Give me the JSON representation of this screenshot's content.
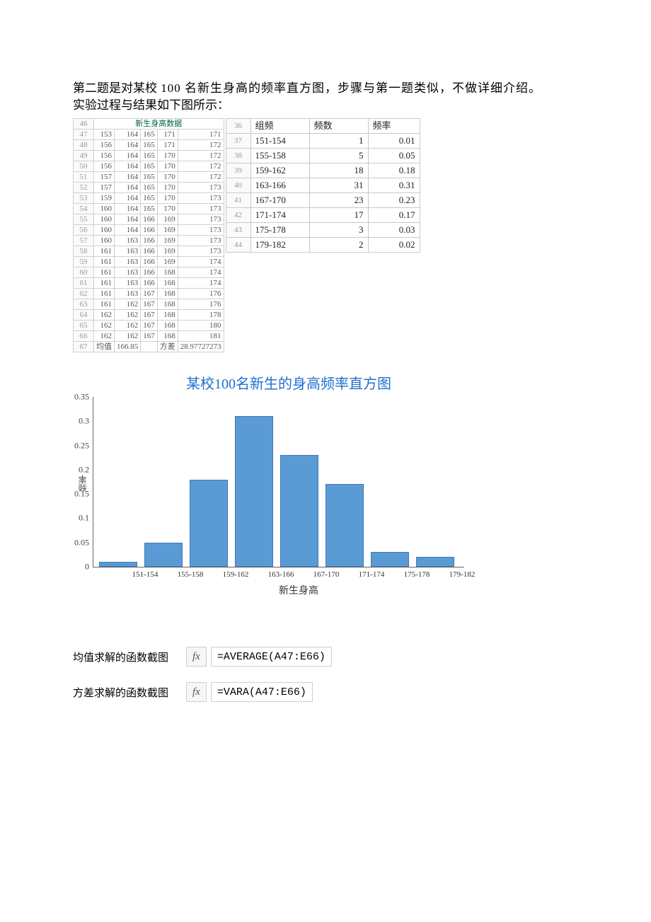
{
  "intro": {
    "line1a": "第二题是对某校",
    "line1b": " 100 名新生身高的频率直方图，步骤与第一题类似，不做详细介绍。",
    "line2": "实验过程与结果如下图所示："
  },
  "sheet1": {
    "header": "新生身高数据",
    "rows": [
      {
        "n": "46",
        "c": [
          "",
          "",
          "",
          "",
          ""
        ]
      },
      {
        "n": "47",
        "c": [
          "153",
          "164",
          "165",
          "171",
          "171"
        ]
      },
      {
        "n": "48",
        "c": [
          "156",
          "164",
          "165",
          "171",
          "172"
        ]
      },
      {
        "n": "49",
        "c": [
          "156",
          "164",
          "165",
          "170",
          "172"
        ]
      },
      {
        "n": "50",
        "c": [
          "156",
          "164",
          "165",
          "170",
          "172"
        ]
      },
      {
        "n": "51",
        "c": [
          "157",
          "164",
          "165",
          "170",
          "172"
        ]
      },
      {
        "n": "52",
        "c": [
          "157",
          "164",
          "165",
          "170",
          "173"
        ]
      },
      {
        "n": "53",
        "c": [
          "159",
          "164",
          "165",
          "170",
          "173"
        ]
      },
      {
        "n": "54",
        "c": [
          "160",
          "164",
          "165",
          "170",
          "173"
        ]
      },
      {
        "n": "55",
        "c": [
          "160",
          "164",
          "166",
          "169",
          "173"
        ]
      },
      {
        "n": "56",
        "c": [
          "160",
          "164",
          "166",
          "169",
          "173"
        ]
      },
      {
        "n": "57",
        "c": [
          "160",
          "163",
          "166",
          "169",
          "173"
        ]
      },
      {
        "n": "58",
        "c": [
          "161",
          "163",
          "166",
          "169",
          "173"
        ]
      },
      {
        "n": "59",
        "c": [
          "161",
          "163",
          "166",
          "169",
          "174"
        ]
      },
      {
        "n": "60",
        "c": [
          "161",
          "163",
          "166",
          "168",
          "174"
        ]
      },
      {
        "n": "61",
        "c": [
          "161",
          "163",
          "166",
          "168",
          "174"
        ]
      },
      {
        "n": "62",
        "c": [
          "161",
          "163",
          "167",
          "168",
          "176"
        ]
      },
      {
        "n": "63",
        "c": [
          "161",
          "162",
          "167",
          "168",
          "176"
        ]
      },
      {
        "n": "64",
        "c": [
          "162",
          "162",
          "167",
          "168",
          "178"
        ]
      },
      {
        "n": "65",
        "c": [
          "162",
          "162",
          "167",
          "168",
          "180"
        ]
      },
      {
        "n": "66",
        "c": [
          "162",
          "162",
          "167",
          "168",
          "181"
        ]
      }
    ],
    "footer": {
      "n": "67",
      "label_a": "均值",
      "val_a": "166.85",
      "label_b": "方差",
      "val_b": "28.97727273"
    }
  },
  "sheet2": {
    "rows": [
      {
        "n": "36",
        "bin": "组频",
        "cnt": "频数",
        "freq": "频率"
      },
      {
        "n": "37",
        "bin": "151-154",
        "cnt": "1",
        "freq": "0.01"
      },
      {
        "n": "38",
        "bin": "155-158",
        "cnt": "5",
        "freq": "0.05"
      },
      {
        "n": "39",
        "bin": "159-162",
        "cnt": "18",
        "freq": "0.18"
      },
      {
        "n": "40",
        "bin": "163-166",
        "cnt": "31",
        "freq": "0.31"
      },
      {
        "n": "41",
        "bin": "167-170",
        "cnt": "23",
        "freq": "0.23"
      },
      {
        "n": "42",
        "bin": "171-174",
        "cnt": "17",
        "freq": "0.17"
      },
      {
        "n": "43",
        "bin": "175-178",
        "cnt": "3",
        "freq": "0.03"
      },
      {
        "n": "44",
        "bin": "179-182",
        "cnt": "2",
        "freq": "0.02"
      }
    ]
  },
  "chart_data": {
    "type": "bar",
    "title": "某校100名新生的身高频率直方图",
    "xlabel": "新生身高",
    "ylabel": "频率",
    "categories": [
      "151-154",
      "155-158",
      "159-162",
      "163-166",
      "167-170",
      "171-174",
      "175-178",
      "179-182"
    ],
    "values": [
      0.01,
      0.05,
      0.18,
      0.31,
      0.23,
      0.17,
      0.03,
      0.02
    ],
    "ylim": [
      0,
      0.35
    ],
    "yticks": [
      "0",
      "0.05",
      "0.1",
      "0.15",
      "0.2",
      "0.25",
      "0.3",
      "0.35"
    ]
  },
  "formulas": {
    "mean_label": "均值求解的函数截图",
    "var_label": "方差求解的函数截图",
    "fx": "fx",
    "mean_formula": "=AVERAGE(A47:E66)",
    "var_formula": "=VARA(A47:E66)"
  }
}
